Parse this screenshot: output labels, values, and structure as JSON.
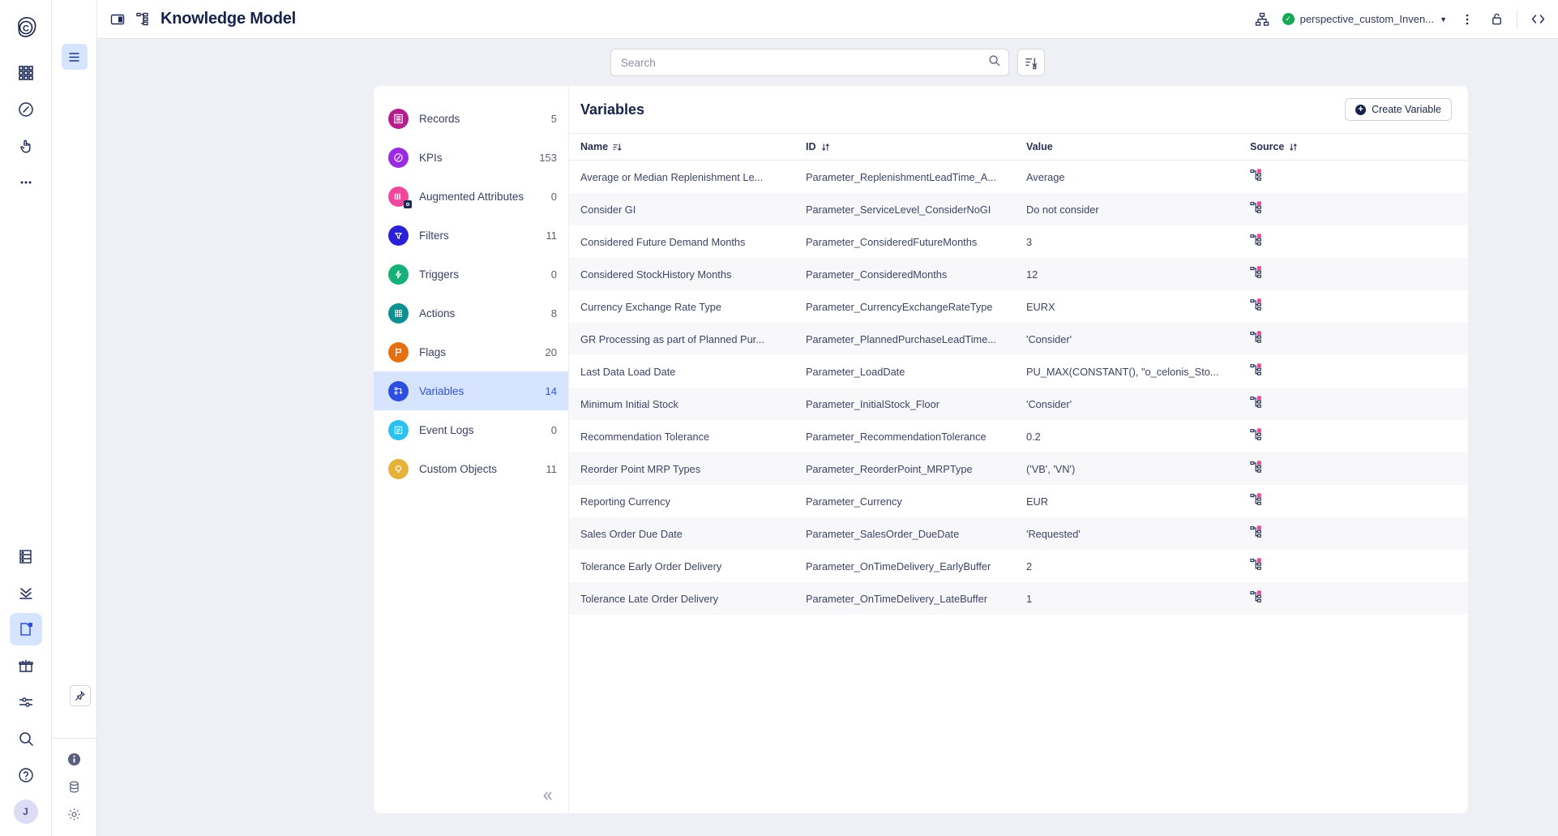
{
  "rail": {
    "logo_icon": "celonis-logo-icon",
    "top_items": [
      {
        "name": "apps-grid-icon",
        "label": "Apps"
      },
      {
        "name": "compass-icon",
        "label": "Explore"
      },
      {
        "name": "hand-pointer-icon",
        "label": "Actions"
      },
      {
        "name": "more-dots-icon",
        "label": "More"
      }
    ],
    "bottom_items": [
      {
        "name": "data-table-icon",
        "label": "Data Model"
      },
      {
        "name": "chevrons-down-icon",
        "label": "Transformations"
      },
      {
        "name": "knowledge-model-icon",
        "label": "Knowledge Model",
        "active": true
      },
      {
        "name": "package-open-icon",
        "label": "Packages"
      },
      {
        "name": "sliders-icon",
        "label": "Settings"
      },
      {
        "name": "search-icon",
        "label": "Search"
      },
      {
        "name": "help-circle-icon",
        "label": "Help"
      }
    ],
    "avatar_initial": "J"
  },
  "strip": {
    "panel_toggle_icon": "list-panel-icon",
    "pin_icon": "pin-icon",
    "bottom_icons": [
      {
        "name": "info-icon"
      },
      {
        "name": "database-icon"
      },
      {
        "name": "gear-icon"
      }
    ]
  },
  "topbar": {
    "sidebar_toggle_icon": "sidebar-toggle-icon",
    "title_icon": "knowledge-model-tree-icon",
    "title": "Knowledge Model",
    "hierarchy_icon": "hierarchy-icon",
    "perspective_label": "perspective_custom_Inven...",
    "perspective_status": "validated",
    "status_color": "#18a957",
    "chevron_icon": "chevron-down-icon",
    "kebab_icon": "more-vertical-icon",
    "lock_icon": "unlock-icon",
    "code_icon": "code-brackets-icon"
  },
  "search": {
    "placeholder": "Search",
    "value": "",
    "search_icon": "search-icon",
    "sort_button_icon": "sort-arrows-icon"
  },
  "sidebar": {
    "items": [
      {
        "label": "Records",
        "count": "5",
        "icon": "records-icon",
        "color": "#b61e8e"
      },
      {
        "label": "KPIs",
        "count": "153",
        "icon": "kpis-icon",
        "color": "#9c2ae0"
      },
      {
        "label": "Augmented Attributes",
        "count": "0",
        "icon": "augmented-attributes-icon",
        "color": "#f0469b"
      },
      {
        "label": "Filters",
        "count": "11",
        "icon": "filters-icon",
        "color": "#2a21d6"
      },
      {
        "label": "Triggers",
        "count": "0",
        "icon": "triggers-icon",
        "color": "#17b079"
      },
      {
        "label": "Actions",
        "count": "8",
        "icon": "actions-icon",
        "color": "#0f9090"
      },
      {
        "label": "Flags",
        "count": "20",
        "icon": "flags-icon",
        "color": "#e5700f"
      },
      {
        "label": "Variables",
        "count": "14",
        "icon": "variables-icon",
        "color": "#2d4fe0",
        "active": true
      },
      {
        "label": "Event Logs",
        "count": "0",
        "icon": "event-logs-icon",
        "color": "#2bc1f0"
      },
      {
        "label": "Custom Objects",
        "count": "11",
        "icon": "custom-objects-icon",
        "color": "#e8b23a"
      }
    ],
    "collapse_icon": "chevrons-left-icon"
  },
  "main": {
    "title": "Variables",
    "create_button": "Create Variable",
    "create_button_icon": "plus-circle-icon",
    "columns": [
      {
        "label": "Name",
        "sort": "desc"
      },
      {
        "label": "ID",
        "sort": "none"
      },
      {
        "label": "Value",
        "sort": null
      },
      {
        "label": "Source",
        "sort": "none"
      }
    ],
    "source_icon": "source-tree-icon",
    "rows": [
      {
        "name": "Average or Median Replenishment Le...",
        "id": "Parameter_ReplenishmentLeadTime_A...",
        "value": "Average"
      },
      {
        "name": "Consider GI",
        "id": "Parameter_ServiceLevel_ConsiderNoGI",
        "value": "Do not consider"
      },
      {
        "name": "Considered Future Demand Months",
        "id": "Parameter_ConsideredFutureMonths",
        "value": "3"
      },
      {
        "name": "Considered StockHistory Months",
        "id": "Parameter_ConsideredMonths",
        "value": "12"
      },
      {
        "name": "Currency Exchange Rate Type",
        "id": "Parameter_CurrencyExchangeRateType",
        "value": "EURX"
      },
      {
        "name": "GR Processing as part of Planned Pur...",
        "id": "Parameter_PlannedPurchaseLeadTime...",
        "value": "'Consider'"
      },
      {
        "name": "Last Data Load Date",
        "id": "Parameter_LoadDate",
        "value": "PU_MAX(CONSTANT(), \"o_celonis_Sto..."
      },
      {
        "name": "Minimum Initial Stock",
        "id": "Parameter_InitialStock_Floor",
        "value": "'Consider'"
      },
      {
        "name": "Recommendation Tolerance",
        "id": "Parameter_RecommendationTolerance",
        "value": "0.2"
      },
      {
        "name": "Reorder Point MRP Types",
        "id": "Parameter_ReorderPoint_MRPType",
        "value": "('VB', 'VN')"
      },
      {
        "name": "Reporting Currency",
        "id": "Parameter_Currency",
        "value": "EUR"
      },
      {
        "name": "Sales Order Due Date",
        "id": "Parameter_SalesOrder_DueDate",
        "value": "'Requested'"
      },
      {
        "name": "Tolerance Early Order Delivery",
        "id": "Parameter_OnTimeDelivery_EarlyBuffer",
        "value": "2"
      },
      {
        "name": "Tolerance Late Order Delivery",
        "id": "Parameter_OnTimeDelivery_LateBuffer",
        "value": "1"
      }
    ]
  }
}
